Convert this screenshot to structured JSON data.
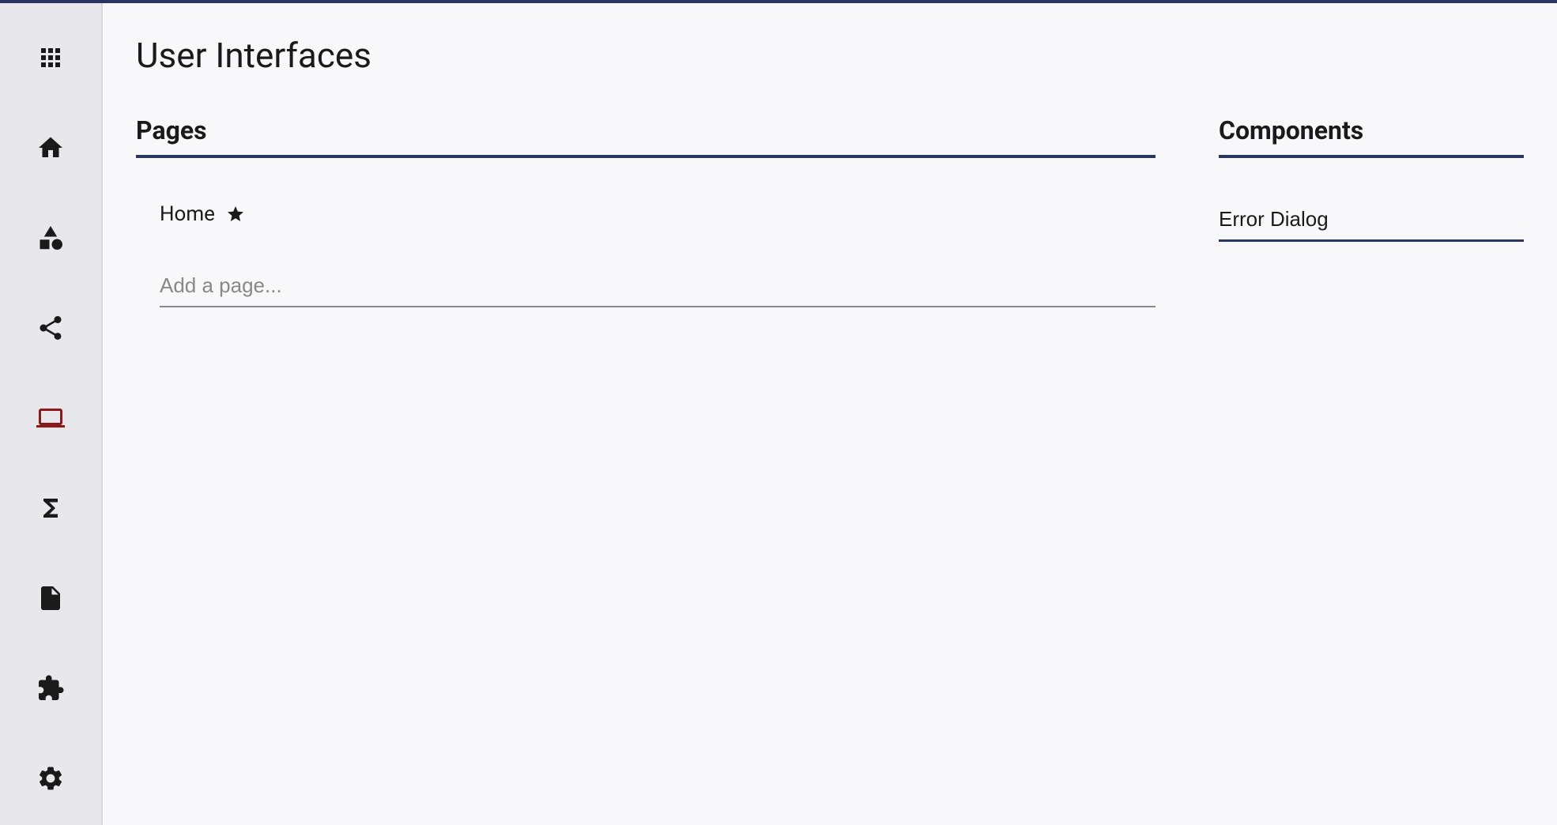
{
  "page": {
    "title": "User Interfaces"
  },
  "sections": {
    "pages_heading": "Pages",
    "components_heading": "Components"
  },
  "pages": {
    "items": [
      {
        "label": "Home",
        "starred": true
      }
    ],
    "add_placeholder": "Add a page..."
  },
  "components": {
    "input_value": "Error Dialog"
  },
  "sidebar": {
    "items": [
      {
        "name": "apps-icon"
      },
      {
        "name": "home-icon"
      },
      {
        "name": "shapes-icon"
      },
      {
        "name": "share-icon"
      },
      {
        "name": "laptop-icon",
        "active": true
      },
      {
        "name": "sigma-icon"
      },
      {
        "name": "file-icon"
      },
      {
        "name": "extension-icon"
      },
      {
        "name": "settings-icon"
      }
    ]
  },
  "colors": {
    "accent": "#2a3560",
    "active_icon": "#8c1a1a"
  }
}
